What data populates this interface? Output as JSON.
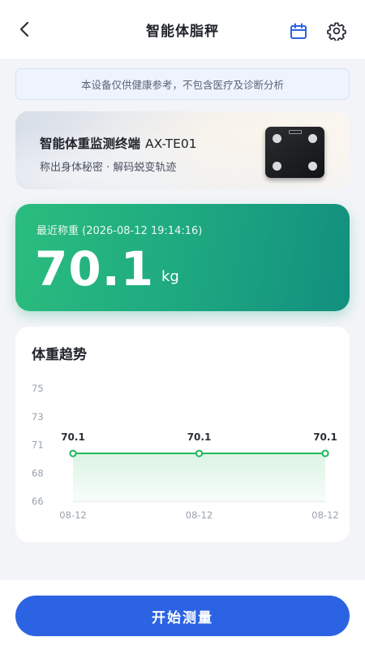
{
  "header": {
    "title": "智能体脂秤",
    "back_icon": "chevron-left-icon",
    "calendar_icon": "calendar-icon",
    "settings_icon": "gear-icon"
  },
  "disclaimer": {
    "text": "本设备仅供健康参考，不包含医疗及诊断分析"
  },
  "device": {
    "name": "智能体重监测终端",
    "model": "AX-TE01",
    "slogan": "称出身体秘密 · 解码蜕变轨迹"
  },
  "latest_weight": {
    "label": "最近称重 (2026-08-12 19:14:16)",
    "value": "70.1",
    "unit": "kg"
  },
  "trend": {
    "title": "体重趋势"
  },
  "chart_data": {
    "type": "area",
    "title": "体重趋势",
    "xlabel": "",
    "ylabel": "",
    "y_ticks": [
      75,
      73,
      71,
      68,
      66
    ],
    "ylim": [
      66,
      75
    ],
    "categories": [
      "08-12",
      "08-12",
      "08-12"
    ],
    "values": [
      70.1,
      70.1,
      70.1
    ],
    "data_labels": [
      "70.1",
      "70.1",
      "70.1"
    ],
    "grid": false,
    "line_color": "#1fb85a"
  },
  "actions": {
    "start_label": "开始测量"
  },
  "colors": {
    "accent_blue": "#2c63e3",
    "weight_card_green": "#1ea980",
    "line_green": "#1fb85a"
  }
}
